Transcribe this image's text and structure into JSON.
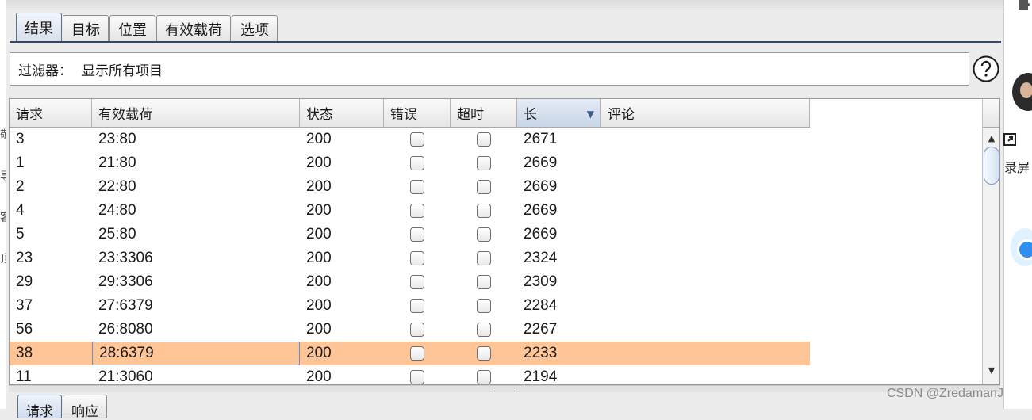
{
  "left_margin_glyphs": [
    "敬",
    "导",
    "客",
    "顶"
  ],
  "right_panel": {
    "screen_label": "录屏"
  },
  "tabs": [
    {
      "label": "结果",
      "active": true
    },
    {
      "label": "目标",
      "active": false
    },
    {
      "label": "位置",
      "active": false
    },
    {
      "label": "有效载荷",
      "active": false
    },
    {
      "label": "选项",
      "active": false
    }
  ],
  "filter": {
    "label": "过滤器：",
    "value": "显示所有项目"
  },
  "table": {
    "columns": [
      "请求",
      "有效载荷",
      "状态",
      "错误",
      "超时",
      "长",
      "评论"
    ],
    "sorted_column": "长",
    "sort_direction": "descending",
    "rows": [
      {
        "request": "3",
        "payload": "23:80",
        "status": "200",
        "error": false,
        "timeout": false,
        "length": "2671",
        "comment": ""
      },
      {
        "request": "1",
        "payload": "21:80",
        "status": "200",
        "error": false,
        "timeout": false,
        "length": "2669",
        "comment": ""
      },
      {
        "request": "2",
        "payload": "22:80",
        "status": "200",
        "error": false,
        "timeout": false,
        "length": "2669",
        "comment": ""
      },
      {
        "request": "4",
        "payload": "24:80",
        "status": "200",
        "error": false,
        "timeout": false,
        "length": "2669",
        "comment": ""
      },
      {
        "request": "5",
        "payload": "25:80",
        "status": "200",
        "error": false,
        "timeout": false,
        "length": "2669",
        "comment": ""
      },
      {
        "request": "23",
        "payload": "23:3306",
        "status": "200",
        "error": false,
        "timeout": false,
        "length": "2324",
        "comment": ""
      },
      {
        "request": "29",
        "payload": "29:3306",
        "status": "200",
        "error": false,
        "timeout": false,
        "length": "2309",
        "comment": ""
      },
      {
        "request": "37",
        "payload": "27:6379",
        "status": "200",
        "error": false,
        "timeout": false,
        "length": "2284",
        "comment": ""
      },
      {
        "request": "56",
        "payload": "26:8080",
        "status": "200",
        "error": false,
        "timeout": false,
        "length": "2267",
        "comment": ""
      },
      {
        "request": "38",
        "payload": "28:6379",
        "status": "200",
        "error": false,
        "timeout": false,
        "length": "2233",
        "comment": "",
        "selected": true
      },
      {
        "request": "11",
        "payload": "21:3060",
        "status": "200",
        "error": false,
        "timeout": false,
        "length": "2194",
        "comment": ""
      }
    ]
  },
  "bottom_tabs": [
    {
      "label": "请求",
      "active": true
    },
    {
      "label": "响应",
      "active": false
    }
  ],
  "watermark": "CSDN @ZredamanJ",
  "colors": {
    "selected_row": "#ffc597",
    "tab_underline": "#34466a",
    "sorted_header": "#c9d6e8"
  }
}
